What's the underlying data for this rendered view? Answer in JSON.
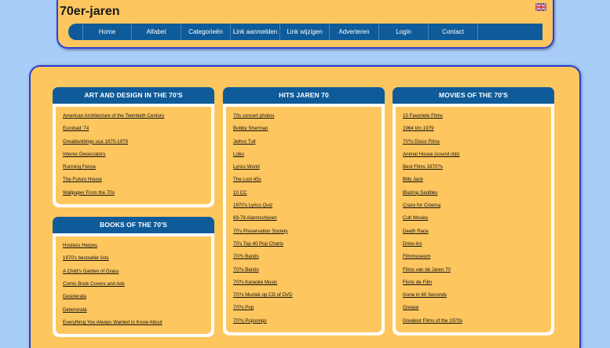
{
  "site": {
    "title": "70er-jaren",
    "flag_icon": "uk-flag-icon"
  },
  "nav": [
    "Home",
    "Alfabet",
    "Categorieën",
    "Link aanmelden",
    "Link wijzigen",
    "Adverteren",
    "Login",
    "Contact"
  ],
  "colors": {
    "page_bg": "#a9cdf9",
    "panel": "#fdc65f",
    "nav": "#0f5b9a",
    "border": "#2c3fd6"
  },
  "sections": {
    "art": {
      "title": "ART AND DESIGN IN THE 70'S",
      "links": [
        "American Architecture of the Twentieth Century",
        "Eurobad '74",
        "Greatbuildings usa 1970-1979",
        "Interior Desecrators",
        "Running Fence",
        "The Futuro House",
        "Wallpaper From the 70s"
      ]
    },
    "books": {
      "title": "BOOKS OF THE 70'S",
      "links": [
        "Hostess Herpes",
        "1970's bestseller lists",
        "A Child's Garden of Grass",
        "Comic Book Covers and Ads",
        "Desiderata",
        "Deteriorata",
        "Everything You Always Wanted to Know About"
      ]
    },
    "hits": {
      "title": "HITS JAREN 70",
      "links": [
        "70s concert photos",
        "Bobby Sherman",
        "Jethro Tull",
        "Lobo",
        "Lyrics World",
        "The Lost 45s",
        "10 CC",
        "1970's Lyrics Quiz",
        "69-79 Alarmschijven",
        "70's Preservation Society",
        "70's Top 40 Pop Charts",
        "70?s Bands",
        "70?s Bands",
        "70?s Karaoke Music",
        "70?s Muziek op CD of DVD",
        "70?s Pop",
        "70?s Popsongs"
      ]
    },
    "movies": {
      "title": "MOVIES OF THE 70'S",
      "links": [
        "10 Favoriete Films",
        "1964 t/m 1979",
        "70?s Disco Films",
        "Animal House (sound clip)",
        "Best Films 1970?s",
        "Billy Jack",
        "Blazing Saddles",
        "Crazy for Cinema",
        "Cult Movies",
        "Death Race",
        "Drive-ins",
        "Filmmuseum",
        "Films van de Jaren 70",
        "Floris de Film",
        "Gone in 60 Seconds",
        "Grease",
        "Greatest Films of the 1970s"
      ]
    }
  }
}
